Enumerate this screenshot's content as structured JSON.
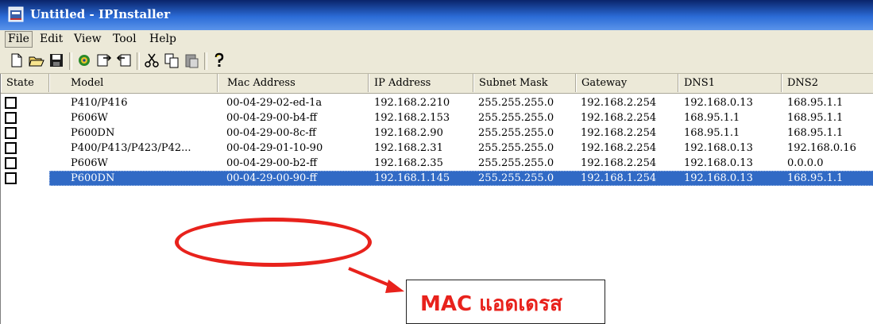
{
  "window": {
    "title": "Untitled - IPInstaller"
  },
  "menu": [
    {
      "label": "File",
      "active": true
    },
    {
      "label": "Edit"
    },
    {
      "label": "View"
    },
    {
      "label": "Tool"
    },
    {
      "label": "Help"
    }
  ],
  "toolbar": {
    "buttons": [
      "new-icon",
      "open-icon",
      "save-icon",
      "search-devices-icon",
      "import-icon",
      "export-icon",
      "cut-icon",
      "copy-icon",
      "paste-icon",
      "help-icon"
    ]
  },
  "table": {
    "columns": [
      "State",
      "Model",
      "Mac Address",
      "IP Address",
      "Subnet Mask",
      "Gateway",
      "DNS1",
      "DNS2"
    ],
    "rows": [
      [
        "",
        "P410/P416",
        "00-04-29-02-ed-1a",
        "192.168.2.210",
        "255.255.255.0",
        "192.168.2.254",
        "192.168.0.13",
        "168.95.1.1"
      ],
      [
        "",
        "P606W",
        "00-04-29-00-b4-ff",
        "192.168.2.153",
        "255.255.255.0",
        "192.168.2.254",
        "168.95.1.1",
        "168.95.1.1"
      ],
      [
        "",
        "P600DN",
        "00-04-29-00-8c-ff",
        "192.168.2.90",
        "255.255.255.0",
        "192.168.2.254",
        "168.95.1.1",
        "168.95.1.1"
      ],
      [
        "",
        "P400/P413/P423/P42...",
        "00-04-29-01-10-90",
        "192.168.2.31",
        "255.255.255.0",
        "192.168.2.254",
        "192.168.0.13",
        "192.168.0.16"
      ],
      [
        "",
        "P606W",
        "00-04-29-00-b2-ff",
        "192.168.2.35",
        "255.255.255.0",
        "192.168.2.254",
        "192.168.0.13",
        "0.0.0.0"
      ],
      [
        "",
        "P600DN",
        "00-04-29-00-90-ff",
        "192.168.1.145",
        "255.255.255.0",
        "192.168.1.254",
        "192.168.0.13",
        "168.95.1.1"
      ]
    ],
    "selected_row": 5
  },
  "annotation": {
    "callout_text": "MAC แอดเดรส",
    "color": "#e8221c"
  }
}
